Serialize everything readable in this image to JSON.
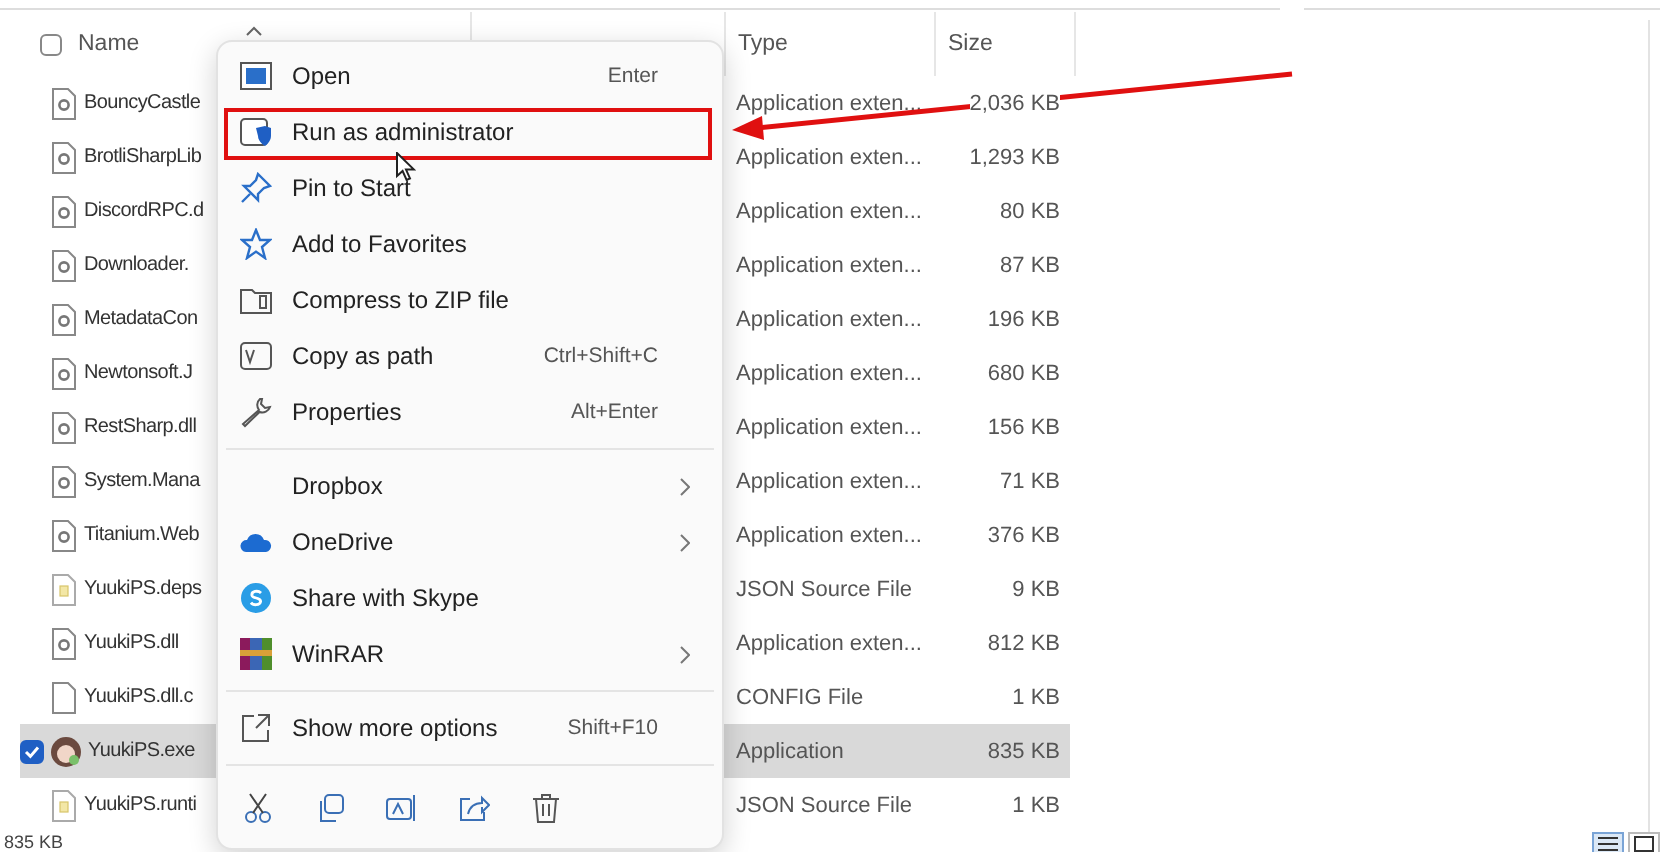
{
  "header_checkbox": {
    "checked": false
  },
  "columns": [
    {
      "label": "Name",
      "sort_ascending": true
    },
    {
      "label": "Type"
    },
    {
      "label": "Size"
    }
  ],
  "rows": [
    {
      "name": "BouncyCastle",
      "kind": "dll",
      "type": "Application exten...",
      "size": "2,036 KB",
      "selected": false
    },
    {
      "name": "BrotliSharpLib",
      "kind": "dll",
      "type": "Application exten...",
      "size": "1,293 KB",
      "selected": false
    },
    {
      "name": "DiscordRPC.d",
      "kind": "dll",
      "type": "Application exten...",
      "size": "80 KB",
      "selected": false
    },
    {
      "name": "Downloader.",
      "kind": "dll",
      "type": "Application exten...",
      "size": "87 KB",
      "selected": false
    },
    {
      "name": "MetadataCon",
      "kind": "dll",
      "type": "Application exten...",
      "size": "196 KB",
      "selected": false
    },
    {
      "name": "Newtonsoft.J",
      "kind": "dll",
      "type": "Application exten...",
      "size": "680 KB",
      "selected": false
    },
    {
      "name": "RestSharp.dll",
      "kind": "dll",
      "type": "Application exten...",
      "size": "156 KB",
      "selected": false
    },
    {
      "name": "System.Mana",
      "kind": "dll",
      "type": "Application exten...",
      "size": "71 KB",
      "selected": false
    },
    {
      "name": "Titanium.Web",
      "kind": "dll",
      "type": "Application exten...",
      "size": "376 KB",
      "selected": false
    },
    {
      "name": "YuukiPS.deps",
      "kind": "json",
      "type": "JSON Source File",
      "size": "9 KB",
      "selected": false
    },
    {
      "name": "YuukiPS.dll",
      "kind": "dll",
      "type": "Application exten...",
      "size": "812 KB",
      "selected": false
    },
    {
      "name": "YuukiPS.dll.c",
      "kind": "config",
      "type": "CONFIG File",
      "size": "1 KB",
      "selected": false
    },
    {
      "name": "YuukiPS.exe",
      "kind": "exe",
      "type": "Application",
      "size": "835 KB",
      "selected": true
    },
    {
      "name": "YuukiPS.runti",
      "kind": "json",
      "type": "JSON Source File",
      "size": "1 KB",
      "selected": false
    }
  ],
  "status_bar": "835 KB",
  "context_menu": {
    "groups": [
      [
        {
          "label": "Open",
          "shortcut": "Enter",
          "annotated": false
        },
        {
          "label": "Run as administrator",
          "annotated": true
        },
        {
          "label": "Pin to Start",
          "annotated": false
        },
        {
          "label": "Add to Favorites",
          "annotated": false
        },
        {
          "label": "Compress to ZIP file",
          "annotated": false
        },
        {
          "label": "Copy as path",
          "shortcut": "Ctrl+Shift+C",
          "annotated": false
        },
        {
          "label": "Properties",
          "shortcut": "Alt+Enter",
          "annotated": false
        }
      ],
      [
        {
          "label": "Dropbox",
          "submenu": true,
          "annotated": false
        },
        {
          "label": "OneDrive",
          "submenu": true,
          "annotated": false
        },
        {
          "label": "Share with Skype",
          "annotated": false
        },
        {
          "label": "WinRAR",
          "submenu": true,
          "annotated": false
        }
      ],
      [
        {
          "label": "Show more options",
          "shortcut": "Shift+F10",
          "annotated": false
        }
      ]
    ]
  }
}
